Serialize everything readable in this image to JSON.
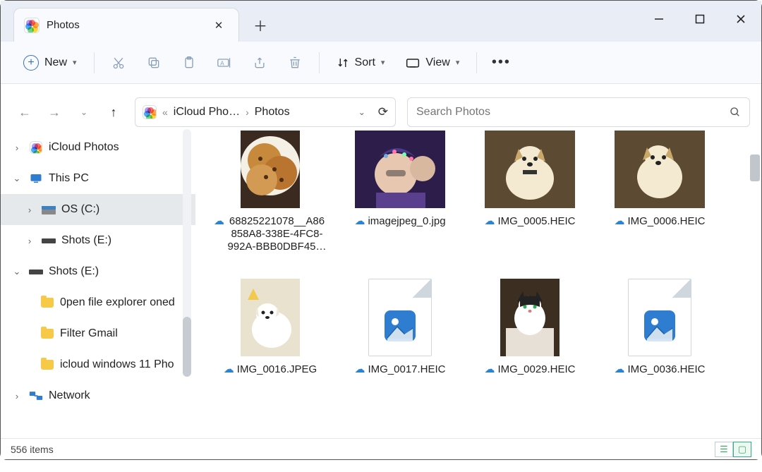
{
  "tab": {
    "title": "Photos"
  },
  "toolbar": {
    "new": "New",
    "sort": "Sort",
    "view": "View"
  },
  "breadcrumb": {
    "root": "iCloud Pho…",
    "leaf": "Photos"
  },
  "search": {
    "placeholder": "Search Photos"
  },
  "tree": {
    "icloud": "iCloud Photos",
    "thispc": "This PC",
    "osc": "OS (C:)",
    "shotse": "Shots (E:)",
    "shotse2": "Shots (E:)",
    "f_open": "0pen file explorer oned",
    "f_filter": "Filter Gmail",
    "f_icloud": "icloud windows 11 Pho",
    "network": "Network"
  },
  "files": [
    {
      "name": "68825221078__A86858A8-338E-4FC8-992A-BBB0DBF45…",
      "thumb": "cookies"
    },
    {
      "name": "imagejpeg_0.jpg",
      "thumb": "selfie"
    },
    {
      "name": "IMG_0005.HEIC",
      "thumb": "dog1"
    },
    {
      "name": "IMG_0006.HEIC",
      "thumb": "dog2"
    },
    {
      "name": "IMG_0016.JPEG",
      "thumb": "puppy"
    },
    {
      "name": "IMG_0017.HEIC",
      "thumb": "doc"
    },
    {
      "name": "IMG_0029.HEIC",
      "thumb": "cat"
    },
    {
      "name": "IMG_0036.HEIC",
      "thumb": "doc"
    }
  ],
  "status": {
    "count": "556 items"
  }
}
